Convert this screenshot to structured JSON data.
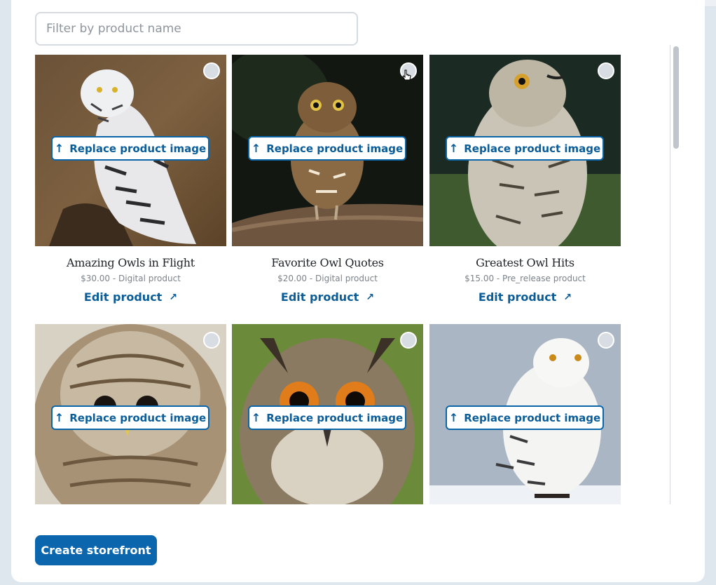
{
  "filter": {
    "placeholder": "Filter by product name",
    "value": ""
  },
  "replace_label": "Replace product image",
  "edit_label": "Edit product",
  "products": [
    {
      "title": "Amazing Owls in Flight",
      "price": "$30.00 - Digital product",
      "image": "snowy-owl-on-branch"
    },
    {
      "title": "Favorite Owl Quotes",
      "price": "$20.00 - Digital product",
      "image": "burrowing-owl-on-log"
    },
    {
      "title": "Greatest Owl Hits",
      "price": "$15.00 - Pre_release product",
      "image": "great-horned-owl"
    },
    {
      "title": "",
      "price": "",
      "image": "barred-owl-closeup"
    },
    {
      "title": "",
      "price": "",
      "image": "eagle-owl-face"
    },
    {
      "title": "",
      "price": "",
      "image": "snowy-owl-in-snow"
    }
  ],
  "create_storefront_label": "Create storefront",
  "colors": {
    "accent": "#0b66ad",
    "accent_text": "#0a5d99",
    "background": "#dfe7ee",
    "panel": "#ffffff"
  }
}
